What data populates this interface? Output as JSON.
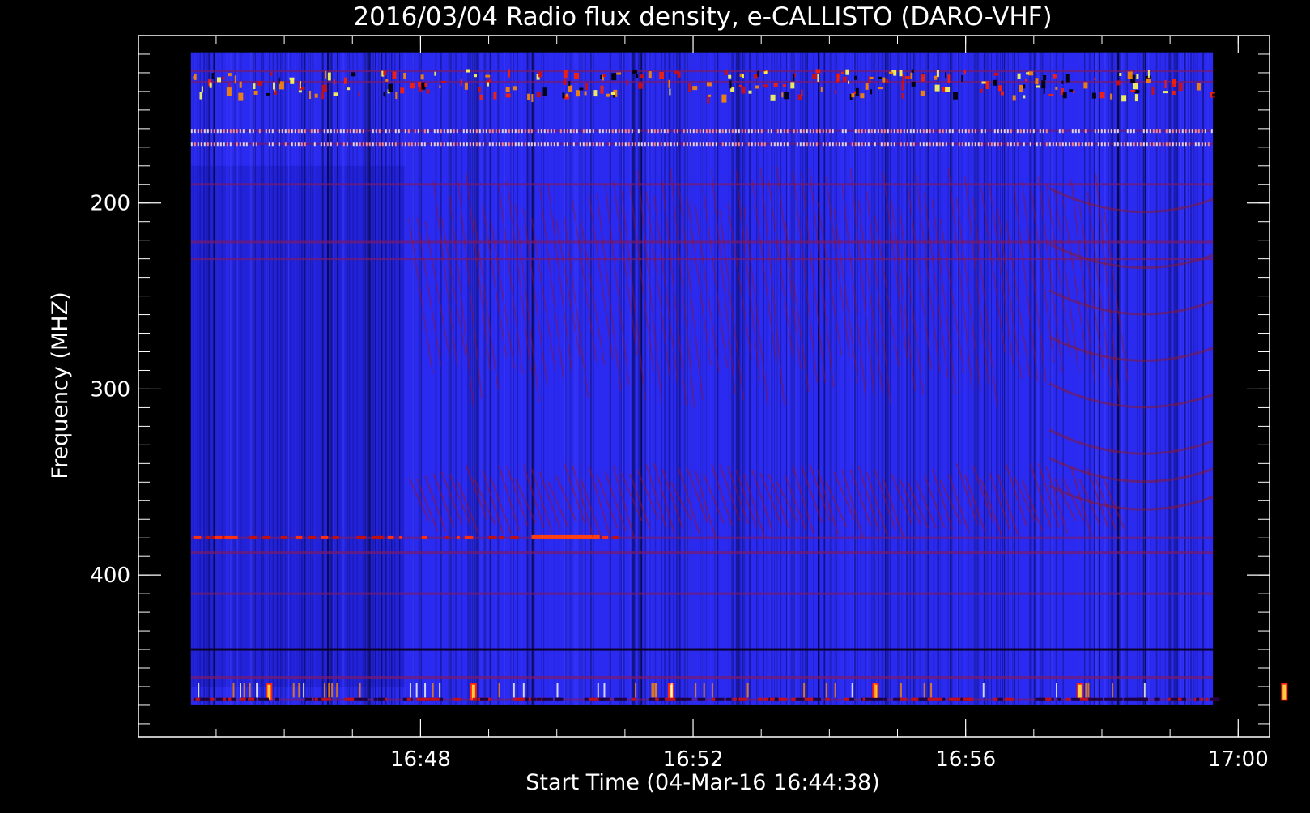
{
  "chart_data": {
    "type": "heatmap",
    "title": "2016/03/04  Radio flux density, e-CALLISTO (DARO-VHF)",
    "xlabel": "Start Time (04-Mar-16 16:44:38)",
    "ylabel": "Frequency (MHZ)",
    "x_ticks": [
      "16:48",
      "16:52",
      "16:56",
      "17:00"
    ],
    "x_tick_values_min": [
      3.37,
      7.37,
      11.37,
      15.37
    ],
    "y_ticks": [
      "200",
      "300",
      "400"
    ],
    "y_tick_values": [
      200,
      300,
      400
    ],
    "xlim_min": [
      -0.77,
      15.83
    ],
    "ylim": [
      110,
      487
    ],
    "y_inverted": true,
    "data_extent_min": [
      0,
      15.0
    ],
    "data_extent_mhz": [
      119,
      470
    ],
    "colormap": [
      "#000000",
      "#1a1a8a",
      "#2020ff",
      "#8a1a4a",
      "#d01010",
      "#ff8800",
      "#ffff66"
    ],
    "background_color": "#2a2af0",
    "rfi_bands_mhz": [
      129,
      135,
      161,
      168,
      190,
      221,
      230,
      380,
      388,
      410,
      440,
      455,
      467
    ],
    "spot_rows_mhz": [
      137,
      379,
      462
    ],
    "spot_times_min": [
      1.1,
      4.1,
      7.0,
      10.0,
      13.0,
      16.0
    ]
  }
}
